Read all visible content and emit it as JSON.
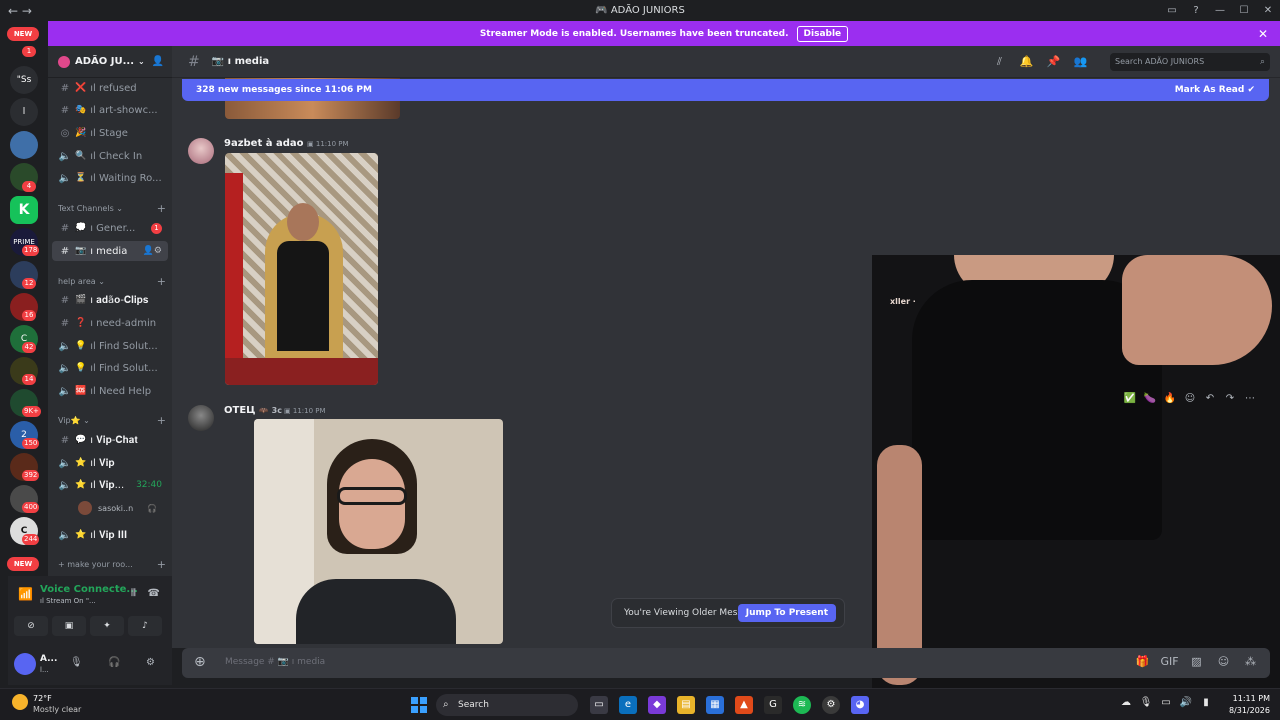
{
  "window": {
    "title": "ADÃO JUNIORS",
    "back": "←",
    "forward": "→"
  },
  "banner": {
    "text": "Streamer Mode is enabled. Usernames have been truncated.",
    "disable": "Disable"
  },
  "rail": {
    "dm_text": "\"Ss",
    "second_text": "l",
    "new_badge": "NEW",
    "badges": [
      "1",
      "4",
      "178",
      "12",
      "16",
      "42",
      "14",
      "9K+",
      "150",
      "392",
      "400",
      "244"
    ]
  },
  "server": {
    "name": "ADÃO JU..."
  },
  "sidebar": {
    "channels_top": [
      {
        "label": "ıl refused",
        "emoji": "❌",
        "icon": "#"
      },
      {
        "label": "ıl art-showc...",
        "emoji": "🎭",
        "icon": "#"
      },
      {
        "label": "ıl Stage",
        "emoji": "🎉",
        "icon": "◎"
      },
      {
        "label": "ıl Check In",
        "emoji": "🔍",
        "icon": "🔈"
      },
      {
        "label": "ıl Waiting Ro...",
        "emoji": "⏳",
        "icon": "🔈"
      }
    ],
    "cat_text": "Text Channels",
    "general": {
      "label": "ı Gener...",
      "badge": "1"
    },
    "media": {
      "label": "ı media"
    },
    "cat_help": "help area",
    "help_channels": [
      {
        "label": "ı 𝐚𝐝ã𝐨-𝐂𝐥𝐢𝐩𝐬",
        "emoji": "🎬",
        "icon": "#"
      },
      {
        "label": "ı need-admin",
        "emoji": "❓",
        "icon": "#"
      },
      {
        "label": "ıl Find Solut...",
        "emoji": "💡",
        "icon": "🔈"
      },
      {
        "label": "ıl Find Solut...",
        "emoji": "💡",
        "icon": "🔈"
      },
      {
        "label": "ıl Need Help",
        "emoji": "🆘",
        "icon": "🔈"
      }
    ],
    "cat_vip": "Vip⭐",
    "vip_channels": [
      {
        "label": "ı 𝐕𝐢𝐩-𝐂𝐡𝐚𝐭",
        "emoji": "💬",
        "icon": "#"
      },
      {
        "label": "ıl 𝐕𝐢𝐩",
        "emoji": "⭐",
        "icon": "🔈"
      },
      {
        "label": "ıl 𝐕𝐢𝐩...",
        "emoji": "⭐",
        "icon": "🔈",
        "tail": "32:40"
      }
    ],
    "voice_user": "sasoki..n",
    "vip3": {
      "label": "ıl 𝐕𝐢𝐩 𝐈𝐈𝐈",
      "emoji": "⭐"
    },
    "make_room": "make your roo..."
  },
  "voice": {
    "status": "Voice Connecte...",
    "sub": "ıl Stream On \"..."
  },
  "user": {
    "name": "A...",
    "status": "l..."
  },
  "header": {
    "channel": "ı media",
    "search_placeholder": "Search ADÃO JUNIORS"
  },
  "new_messages": {
    "text": "328 new messages since 11:06 PM",
    "mark": "Mark As Read"
  },
  "messages": [
    {
      "author": "9azbet à adao",
      "time": "11:10 PM"
    },
    {
      "author": "ОТЕЦ",
      "tag": "3c",
      "time": "11:10 PM"
    }
  ],
  "overlay": {
    "line1": "xller ·"
  },
  "reactions": [
    "✅",
    "🍆",
    "🔥"
  ],
  "jump": {
    "text": "You're Viewing Older Messages",
    "button": "Jump To Present"
  },
  "composer": {
    "placeholder": "Message # 📷 ı media"
  },
  "taskbar": {
    "temp": "72°F",
    "condition": "Mostly clear",
    "search": "Search",
    "time": "11:11 PM",
    "date": "8/31/2026"
  }
}
